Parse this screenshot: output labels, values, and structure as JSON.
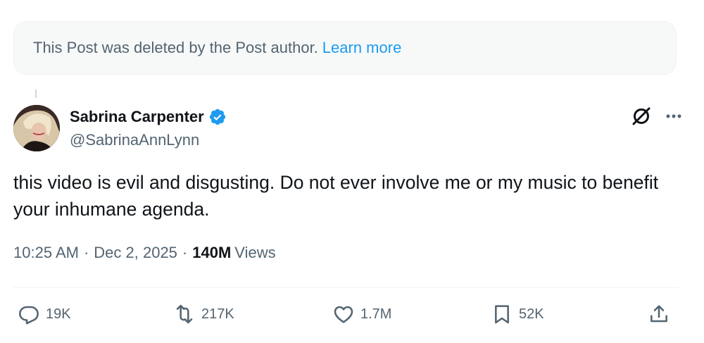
{
  "deleted_notice": {
    "text": "This Post was deleted by the Post author.",
    "link_label": "Learn more"
  },
  "author": {
    "display_name": "Sabrina Carpenter",
    "handle": "@SabrinaAnnLynn",
    "verified": true
  },
  "post": {
    "text": "this video is evil and disgusting. Do not ever involve me or my music to benefit your inhumane agenda.",
    "time": "10:25 AM",
    "date": "Dec 2, 2025",
    "views_count": "140M",
    "views_label": "Views"
  },
  "actions": {
    "replies": "19K",
    "reposts": "217K",
    "likes": "1.7M",
    "bookmarks": "52K"
  },
  "colors": {
    "accent": "#1d9bf0",
    "secondary_text": "#536471",
    "primary_text": "#0f1419",
    "banner_bg": "#f7f9f9"
  },
  "icons": [
    "verified-icon",
    "grok-icon",
    "more-icon",
    "reply-icon",
    "repost-icon",
    "like-icon",
    "bookmark-icon",
    "share-icon"
  ]
}
